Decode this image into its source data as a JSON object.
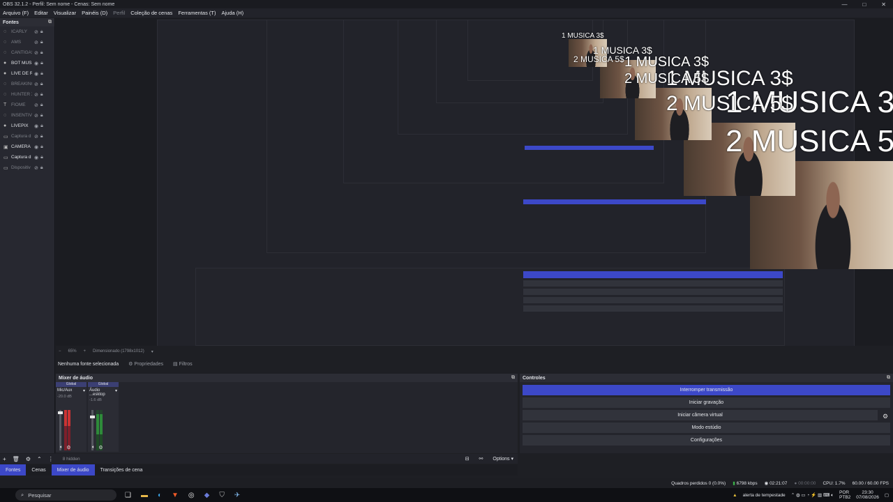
{
  "window": {
    "title": "OBS 32.1.2 - Perfil: Sem nome - Cenas: Sem nome",
    "controls": [
      "—",
      "□",
      "✕"
    ]
  },
  "menu": [
    "Arquivo (F)",
    "Editar",
    "Visualizar",
    "Painéis (D)",
    "Perfil",
    "Coleção de cenas",
    "Ferramentas (T)",
    "Ajuda (H)"
  ],
  "sources": {
    "title": "Fontes",
    "items": [
      {
        "icon": "browser-icon",
        "glyph": "◌",
        "label": "ICARLY",
        "visible": false
      },
      {
        "icon": "browser-icon",
        "glyph": "◌",
        "label": "AMS",
        "visible": false
      },
      {
        "icon": "browser-icon",
        "glyph": "◌",
        "label": "CANTIGAS",
        "visible": false
      },
      {
        "icon": "browser-icon",
        "glyph": "●",
        "label": "BOT MUSI",
        "visible": true
      },
      {
        "icon": "browser-icon",
        "glyph": "●",
        "label": "LIVE DE R",
        "visible": true
      },
      {
        "icon": "browser-icon",
        "glyph": "◌",
        "label": "BREAKING",
        "visible": false
      },
      {
        "icon": "browser-icon",
        "glyph": "◌",
        "label": "HUNTER X",
        "visible": false
      },
      {
        "icon": "text-icon",
        "glyph": "T",
        "label": "FIOME",
        "visible": false
      },
      {
        "icon": "browser-icon",
        "glyph": "◌",
        "label": "INSENTIV",
        "visible": false
      },
      {
        "icon": "browser-icon",
        "glyph": "●",
        "label": "LIVEPIX",
        "visible": true
      },
      {
        "icon": "window-icon",
        "glyph": "▭",
        "label": "Captura d",
        "visible": false
      },
      {
        "icon": "camera-icon",
        "glyph": "▣",
        "label": "CAMERA",
        "visible": true
      },
      {
        "icon": "window-icon",
        "glyph": "▭",
        "label": "Captura d",
        "visible": true
      },
      {
        "icon": "device-icon",
        "glyph": "▭",
        "label": "Dispositiv",
        "visible": false
      }
    ]
  },
  "preview": {
    "overlay": {
      "line1": "1 MUSICA 3$",
      "line2": "2 MUSICA 5$"
    },
    "zoom": "65%",
    "dimensions": "Dimensionado (1798x1012)"
  },
  "context": {
    "selected": "Nenhuma fonte selecionada",
    "properties": "Propriedades",
    "filters": "Filtros"
  },
  "mixer": {
    "title": "Mixer de áudio",
    "channels": [
      {
        "tag": "Global",
        "name": "Mic/Aux",
        "db": "-20.0 dB"
      },
      {
        "tag": "Global",
        "name": "Áudio ...esktop",
        "db": "-1.6 dB"
      }
    ]
  },
  "controls": {
    "title": "Controles",
    "buttons": [
      "Interromper transmissão",
      "Iniciar gravação",
      "Iniciar câmera virtual",
      "Modo estúdio",
      "Configurações"
    ]
  },
  "toolbar": {
    "hidden_count": "8 hidden",
    "options": "Options"
  },
  "tabs": [
    "Fontes",
    "Cenas",
    "Mixer de áudio",
    "Transições de cena"
  ],
  "status": {
    "dropped": "Quadros perdidos 0 (0.0%)",
    "bitrate": "6798 kbps",
    "stream_time": "02:21:07",
    "rec_time": "00:00:00",
    "cpu": "CPU: 1.7%",
    "fps": "60.00 / 60.00 FPS"
  },
  "taskbar": {
    "search_placeholder": "Pesquisar",
    "weather": "alerta de tempestade",
    "lang": "POR",
    "layout": "PTB2",
    "time": "23:30",
    "date": "07/08/2026"
  },
  "colors": {
    "accent": "#3c48c8",
    "background": "#1e1f24",
    "panel": "#272830"
  }
}
